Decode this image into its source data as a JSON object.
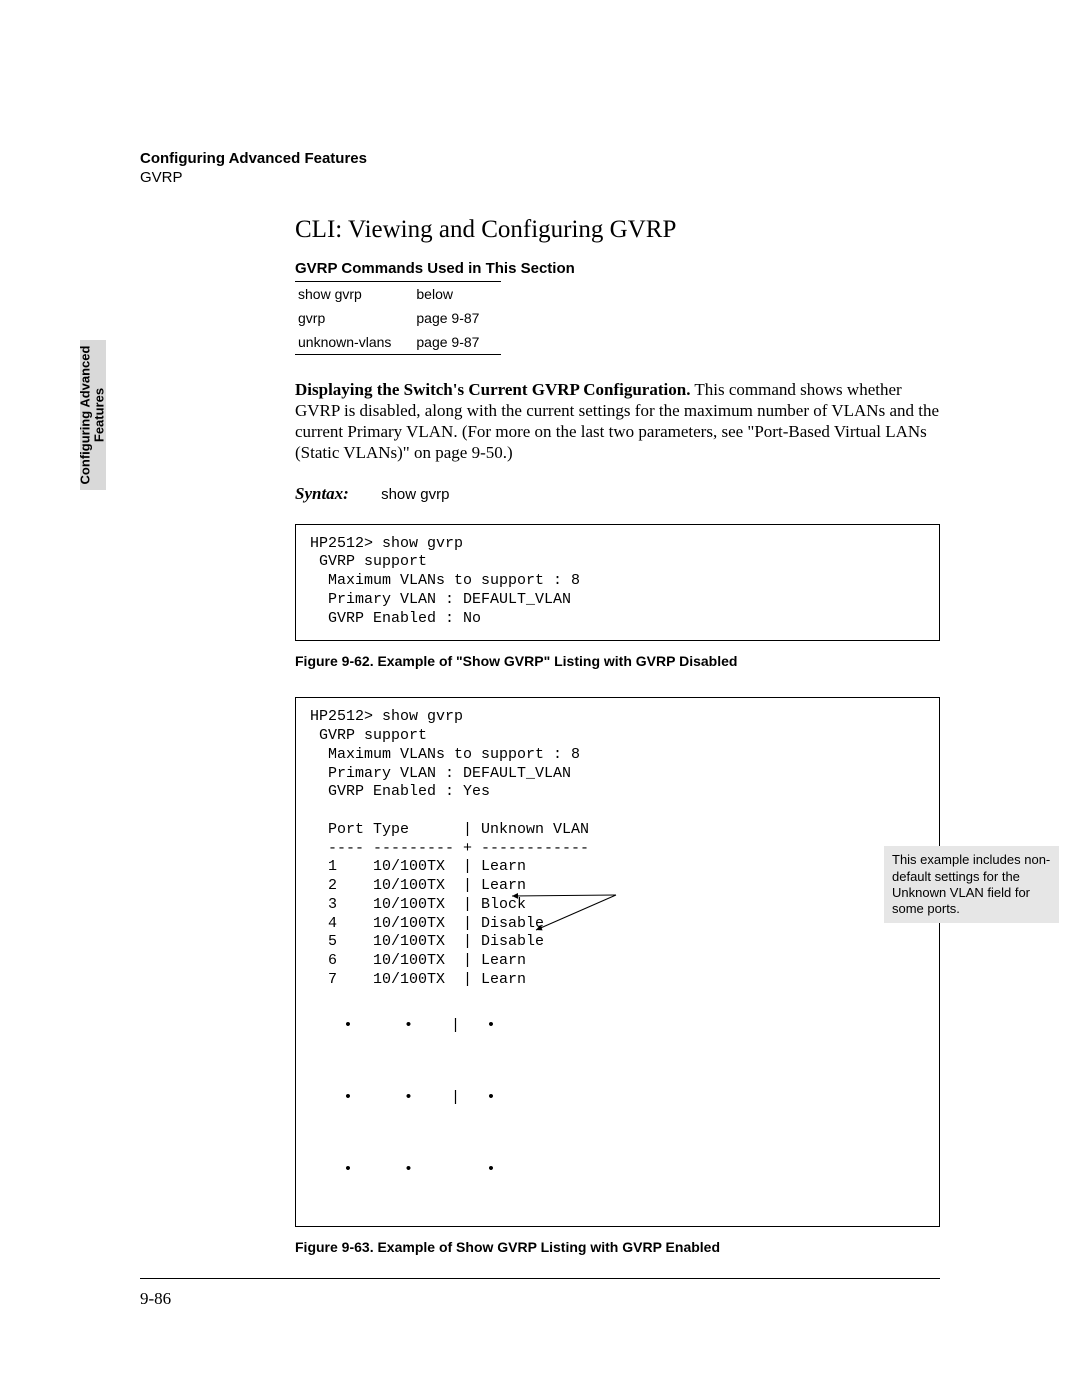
{
  "header": {
    "line1": "Configuring Advanced Features",
    "line2": "GVRP"
  },
  "side_tab": {
    "line1": "Configuring Advanced",
    "line2": "Features"
  },
  "title": "CLI: Viewing and Configuring GVRP",
  "subhead": "GVRP Commands Used in This Section",
  "cmd_table": {
    "rows": [
      {
        "cmd": "show gvrp",
        "ref": "below"
      },
      {
        "cmd": "gvrp",
        "ref": "page 9-87"
      },
      {
        "cmd": "unknown-vlans",
        "ref": "page 9-87"
      }
    ]
  },
  "paragraph": {
    "runin": "Displaying the Switch's Current GVRP Configuration.",
    "body": "  This command shows whether GVRP is disabled, along with the current settings for the maximum number of VLANs and the current Primary VLAN. (For more on the last two parameters, see \"Port-Based Virtual LANs (Static VLANs)\" on page 9-50.)"
  },
  "syntax": {
    "label": "Syntax:",
    "command": "show gvrp"
  },
  "cli1": {
    "lines": [
      "HP2512> show gvrp",
      " GVRP support",
      "  Maximum VLANs to support : 8",
      "  Primary VLAN : DEFAULT_VLAN",
      "  GVRP Enabled : No"
    ]
  },
  "fig1_caption": "Figure 9-62.  Example of \"Show GVRP\" Listing with GVRP Disabled",
  "cli2": {
    "lines": [
      "HP2512> show gvrp",
      " GVRP support",
      "  Maximum VLANs to support : 8",
      "  Primary VLAN : DEFAULT_VLAN",
      "  GVRP Enabled : Yes",
      "",
      "  Port Type      | Unknown VLAN",
      "  ---- --------- + ------------",
      "  1    10/100TX  | Learn",
      "  2    10/100TX  | Learn",
      "  3    10/100TX  | Block",
      "  4    10/100TX  | Disable",
      "  5    10/100TX  | Disable",
      "  6    10/100TX  | Learn",
      "  7    10/100TX  | Learn"
    ]
  },
  "callout": "This example includes non-default settings for the Unknown VLAN field for some ports.",
  "fig2_caption": "Figure 9-63.  Example of Show GVRP Listing with GVRP Enabled",
  "page_number": "9-86"
}
